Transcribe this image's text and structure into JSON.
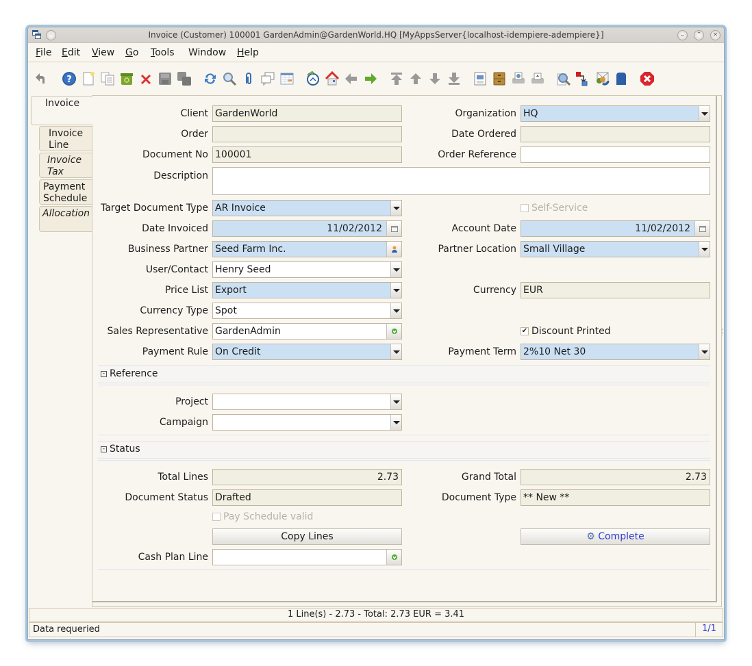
{
  "window": {
    "title": "Invoice (Customer)  100001  GardenAdmin@GardenWorld.HQ [MyAppsServer{localhost-idempiere-adempiere}]"
  },
  "menu": [
    {
      "label": "File",
      "mnemonic": "F",
      "rest": "ile"
    },
    {
      "label": "Edit",
      "mnemonic": "E",
      "rest": "dit"
    },
    {
      "label": "View",
      "mnemonic": "V",
      "rest": "iew"
    },
    {
      "label": "Go",
      "mnemonic": "G",
      "rest": "o"
    },
    {
      "label": "Tools",
      "mnemonic": "T",
      "rest": "ools"
    },
    {
      "label": "Window",
      "mnemonic": "",
      "rest": "Window"
    },
    {
      "label": "Help",
      "mnemonic": "H",
      "rest": "elp"
    }
  ],
  "toolbar": [
    "undo-icon",
    "help-icon",
    "new-record-icon",
    "copy-record-icon",
    "delete-selection-icon",
    "delete-record-icon",
    "save-icon",
    "save-and-create-icon",
    "refresh-icon",
    "find-icon",
    "attachment-icon",
    "chat-icon",
    "grid-toggle-icon",
    "history-icon",
    "home-icon",
    "parent-record-icon",
    "detail-record-icon",
    "first-record-icon",
    "previous-record-icon",
    "next-record-icon",
    "last-record-icon",
    "report-icon",
    "archive-icon",
    "print-preview-icon",
    "print-icon",
    "zoom-across-icon",
    "active-workflows-icon",
    "request-icon",
    "product-info-icon",
    "exit-icon"
  ],
  "tabs": [
    {
      "label": "Invoice",
      "active": true,
      "italic": false
    },
    {
      "label": "Invoice Line",
      "active": false,
      "italic": false
    },
    {
      "label": "Invoice Tax",
      "active": false,
      "italic": true
    },
    {
      "label": "Payment Schedule",
      "active": false,
      "italic": false
    },
    {
      "label": "Allocation",
      "active": false,
      "italic": true
    }
  ],
  "fields": {
    "client": {
      "label": "Client",
      "value": "GardenWorld"
    },
    "organization": {
      "label": "Organization",
      "value": "HQ"
    },
    "order": {
      "label": "Order",
      "value": ""
    },
    "date_ordered": {
      "label": "Date Ordered",
      "value": ""
    },
    "document_no": {
      "label": "Document No",
      "value": "100001"
    },
    "order_reference": {
      "label": "Order Reference",
      "value": ""
    },
    "description": {
      "label": "Description",
      "value": ""
    },
    "target_document_type": {
      "label": "Target Document Type",
      "value": "AR Invoice"
    },
    "self_service": {
      "label": "Self-Service",
      "checked": false
    },
    "date_invoiced": {
      "label": "Date Invoiced",
      "value": "11/02/2012"
    },
    "account_date": {
      "label": "Account Date",
      "value": "11/02/2012"
    },
    "business_partner": {
      "label": "Business Partner",
      "value": "Seed Farm Inc."
    },
    "partner_location": {
      "label": "Partner Location",
      "value": "Small Village"
    },
    "user_contact": {
      "label": "User/Contact",
      "value": "Henry Seed"
    },
    "price_list": {
      "label": "Price List",
      "value": "Export"
    },
    "currency": {
      "label": "Currency",
      "value": "EUR"
    },
    "currency_type": {
      "label": "Currency Type",
      "value": "Spot"
    },
    "sales_rep": {
      "label": "Sales Representative",
      "value": "GardenAdmin"
    },
    "discount_printed": {
      "label": "Discount Printed",
      "checked": true
    },
    "payment_rule": {
      "label": "Payment Rule",
      "value": "On Credit"
    },
    "payment_term": {
      "label": "Payment Term",
      "value": "2%10 Net 30"
    }
  },
  "sections": {
    "reference": {
      "title": "Reference",
      "project": {
        "label": "Project",
        "value": ""
      },
      "campaign": {
        "label": "Campaign",
        "value": ""
      }
    },
    "status": {
      "title": "Status",
      "total_lines": {
        "label": "Total Lines",
        "value": "2.73"
      },
      "grand_total": {
        "label": "Grand Total",
        "value": "2.73"
      },
      "document_status": {
        "label": "Document Status",
        "value": "Drafted"
      },
      "document_type": {
        "label": "Document Type",
        "value": "** New **"
      },
      "pay_schedule_valid": {
        "label": "Pay Schedule valid",
        "checked": false
      },
      "copy_lines_label": "Copy Lines",
      "complete_label": "Complete",
      "cash_plan_line": {
        "label": "Cash Plan Line",
        "value": ""
      }
    }
  },
  "summary": "1 Line(s) - 2.73 -  Total: 2.73  EUR  =  3.41",
  "status": {
    "message": "Data requeried",
    "record": "1/1"
  }
}
